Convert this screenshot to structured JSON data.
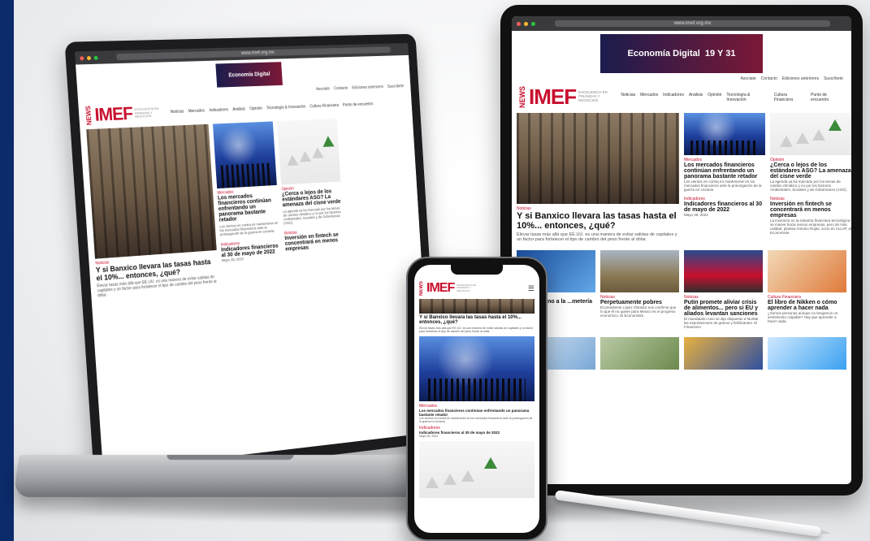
{
  "site": {
    "url": "www.imef.org.mx",
    "brand_news": "NEWS",
    "brand_main": "IMEF",
    "brand_sub": "EXCELENCIA EN FINANZAS Y NEGOCIOS",
    "banner_line1": "Economía",
    "banner_line2": "Digital",
    "banner_dates": "19 Y 31",
    "top_nav": [
      "Asociate",
      "Contacto",
      "Ediciones anteriores",
      "Suscríbete"
    ],
    "main_nav": [
      "Noticias",
      "Mercados",
      "Indicadores",
      "Análisis",
      "Opinión",
      "Tecnología & Innovación",
      "Cultura Financiera",
      "Punto de encuentro"
    ]
  },
  "articles": {
    "banxico": {
      "category": "Noticias",
      "title": "Y si Banxico llevara las tasas hasta el 10%... entonces, ¿qué?",
      "excerpt": "Elevar tasas más allá que EE.UU. es una manera de evitar salidas de capitales y un factor para fortalecer el tipo de cambio del peso frente al dólar."
    },
    "mercados": {
      "category": "Mercados",
      "title": "Los mercados financieros continúan enfrentando un panorama bastante retador",
      "excerpt": "Los vientos en contra en mantenerse en los mercados financieros ante la prolongación de la guerra en Ucrania"
    },
    "asg": {
      "category": "Opinión",
      "title": "¿Cerca o lejos de los estándares ASG? La amenaza del cisne verde",
      "excerpt": "La agenda va ha marcado por los temas de cambio climático y no por los factores Ambientales, Sociales y de Gobernanza (ASG)."
    },
    "indicadores": {
      "category": "Indicadores",
      "title": "Indicadores financieros al 30 de mayo de 2022",
      "date": "Mayo 30, 2022"
    },
    "fintech": {
      "category": "Noticias",
      "title": "Inversión en fintech se concentrará en menos empresas",
      "excerpt": "La inversión en la industria financiera tecnológica se mueve hacia menos empresas, pero de más calidad, plantea Antonio Rojas, socio en ALLVP, al Economista"
    },
    "metaverso": {
      "category": "Noticias",
      "title": "...ero en torno a la ...metería"
    },
    "pobres": {
      "category": "Noticias",
      "title": "Perpetuamente pobres",
      "excerpt": "El presidente López Obrador nos confirma que lo que él no quiere para México es el progreso económico. El Economista"
    },
    "putin": {
      "category": "Noticias",
      "title": "Putin promete aliviar crisis de alimentos... pero si EU y aliados levantan sanciones",
      "excerpt": "El mandatario ruso se dijo dispuesto a facilitar las exportaciones de granos y fertilizantes. El Financiero"
    },
    "nikken": {
      "category": "Cultura Financiera",
      "title": "El libro de Nikken o cómo aprender a hacer nada",
      "excerpt": "¿Somos personas aunque no tengamos un sentimiento culpable? Hay que aprender a hacer nada."
    }
  },
  "colors": {
    "brand_red": "#c8102e",
    "left_band": "#0b2b6b",
    "banner_from": "#1b1c4d",
    "banner_to": "#7b1836"
  }
}
